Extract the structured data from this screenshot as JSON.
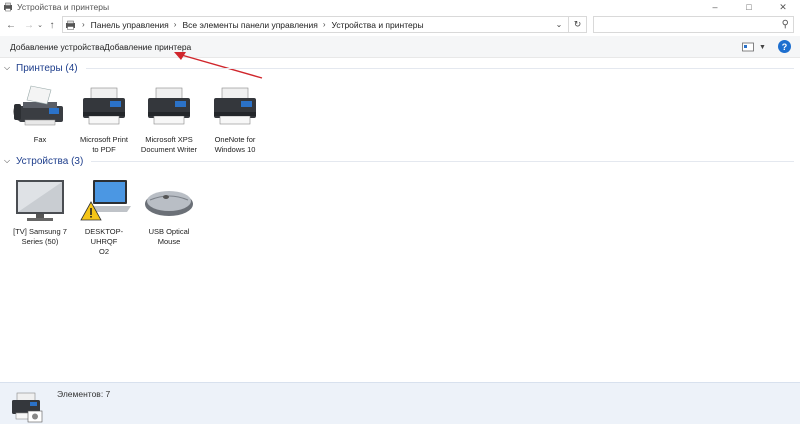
{
  "window": {
    "title": "Устройства и принтеры",
    "app_icon": "devices-printers-icon",
    "controls": {
      "minimize": "–",
      "maximize": "□",
      "close": "✕"
    }
  },
  "nav": {
    "back_icon": "arrow-left-icon",
    "forward_icon": "arrow-right-icon",
    "dropdown_icon": "chevron-down-icon",
    "up_icon": "arrow-up-icon",
    "breadcrumb": [
      "Панель управления",
      "Все элементы панели управления",
      "Устройства и принтеры"
    ],
    "search": {
      "placeholder": "",
      "value": ""
    }
  },
  "toolbar": {
    "add_device": "Добавление устройства",
    "add_printer": "Добавление принтера",
    "view_icon": "view-options-icon",
    "help_label": "?"
  },
  "printers": {
    "title": "Принтеры (4)",
    "items": [
      {
        "label": "Fax",
        "icon": "fax-icon"
      },
      {
        "label": "Microsoft Print\nto PDF",
        "icon": "printer-icon"
      },
      {
        "label": "Microsoft XPS\nDocument Writer",
        "icon": "printer-icon"
      },
      {
        "label": "OneNote for\nWindows 10",
        "icon": "printer-icon"
      }
    ]
  },
  "devices": {
    "title": "Устройства (3)",
    "items": [
      {
        "label": "[TV] Samsung 7\nSeries (50)",
        "icon": "tv-icon"
      },
      {
        "label": "DESKTOP-UHRQF\nO2",
        "icon": "laptop-warning-icon"
      },
      {
        "label": "USB Optical\nMouse",
        "icon": "mouse-icon"
      }
    ]
  },
  "details": {
    "count_text": "Элементов: 7"
  },
  "colors": {
    "group_title": "#1e3e8c",
    "details_bg": "#edf2f9",
    "arrow": "#d0262c",
    "help": "#1e6fcf"
  }
}
